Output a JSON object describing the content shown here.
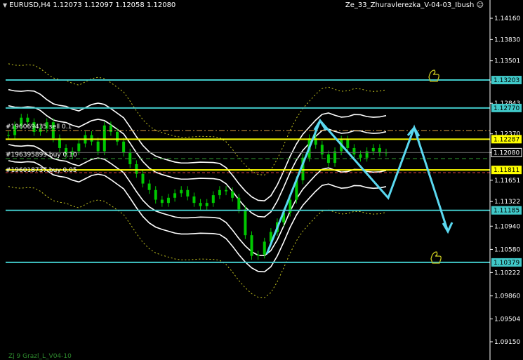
{
  "header": {
    "symbol_ohlc": "EURUSD,H4  1.12073 1.12097 1.12058 1.12080",
    "expert_name": "Ze_33_Zhuravlerezka_V-04-03_Ibush",
    "smiley_icon": "smiley-icon"
  },
  "footer": {
    "indicator_label": "Zj 9 Grazl_L_V04-10"
  },
  "colors": {
    "background": "#000000",
    "grid_axis": "#ffffff",
    "candle": "#00c800",
    "level_lines": "#40c8c8",
    "yellow_lines": "#ffff00",
    "envelope": "#ffffff",
    "dotted_band": "#c8c820",
    "arrow": "#5ad8f0",
    "orange_dash": "#e0a040",
    "red_dash": "#e04040"
  },
  "axis": {
    "ticks": [
      "1.14160",
      "1.13830",
      "1.13501",
      "1.13172",
      "1.12843",
      "1.12370",
      "1.12080",
      "1.11651",
      "1.11322",
      "1.10940",
      "1.10580",
      "1.10222",
      "1.09860",
      "1.09504",
      "1.09150"
    ]
  },
  "levels": [
    {
      "label": "1.13203",
      "kind": "cyan"
    },
    {
      "label": "1.12770",
      "kind": "cyan"
    },
    {
      "label": "1.12287",
      "kind": "yellow"
    },
    {
      "label": "1.12080",
      "kind": "current"
    },
    {
      "label": "1.11811",
      "kind": "yellow"
    },
    {
      "label": "1.11185",
      "kind": "cyan"
    },
    {
      "label": "1.10379",
      "kind": "cyan"
    }
  ],
  "orders": [
    {
      "label": "#196069435 sell 0.1"
    },
    {
      "label": "#196395899 buy 0.10"
    },
    {
      "label": "#196018737 buy 0.05"
    }
  ],
  "chart_data": {
    "type": "candlestick",
    "symbol": "EURUSD",
    "timeframe": "H4",
    "last_ohlc": {
      "open": 1.12073,
      "high": 1.12097,
      "low": 1.12058,
      "close": 1.1208
    },
    "ylim": [
      1.089,
      1.1438
    ],
    "grid": false,
    "close_series": [
      1.1235,
      1.125,
      1.1262,
      1.1255,
      1.124,
      1.1245,
      1.1255,
      1.123,
      1.1215,
      1.1205,
      1.121,
      1.1222,
      1.1235,
      1.1225,
      1.121,
      1.125,
      1.124,
      1.1225,
      1.1208,
      1.119,
      1.1175,
      1.116,
      1.115,
      1.1135,
      1.113,
      1.1138,
      1.1145,
      1.115,
      1.114,
      1.113,
      1.1125,
      1.113,
      1.1142,
      1.115,
      1.1148,
      1.1138,
      1.112,
      1.108,
      1.1048,
      1.105,
      1.107,
      1.1085,
      1.11,
      1.1115,
      1.1135,
      1.1165,
      1.12,
      1.123,
      1.122,
      1.1205,
      1.1192,
      1.121,
      1.1228,
      1.1215,
      1.1205,
      1.12,
      1.121,
      1.1215,
      1.1208,
      1.1208
    ]
  }
}
